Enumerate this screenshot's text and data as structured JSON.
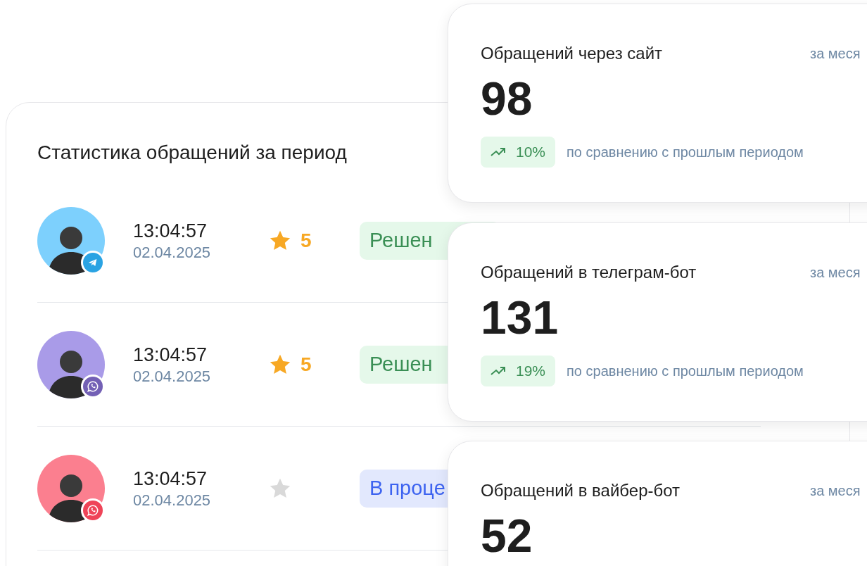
{
  "panel": {
    "title": "Статистика обращений за период",
    "rows": [
      {
        "time": "13:04:57",
        "date": "02.04.2025",
        "color": "#7dd0fd",
        "channel": {
          "kind": "telegram"
        },
        "rated": true,
        "rating": "5",
        "status": {
          "kind": "resolved",
          "label": "Решен"
        }
      },
      {
        "time": "13:04:57",
        "date": "02.04.2025",
        "color": "#a99be8",
        "channel": {
          "kind": "viber"
        },
        "rated": true,
        "rating": "5",
        "status": {
          "kind": "resolved",
          "label": "Решен"
        }
      },
      {
        "time": "13:04:57",
        "date": "02.04.2025",
        "color": "#fb7f8f",
        "channel": {
          "kind": "call"
        },
        "rated": false,
        "status": {
          "kind": "in_progress",
          "label": "В проце"
        }
      }
    ]
  },
  "stat_cards": [
    {
      "title": "Обращений через сайт",
      "period": "за меся",
      "value": "98",
      "change": "10%",
      "comparison": "по сравнению с прошлым периодом"
    },
    {
      "title": "Обращений в телеграм-бот",
      "period": "за меся",
      "value": "131",
      "change": "19%",
      "comparison": "по сравнению с прошлым периодом"
    },
    {
      "title": "Обращений в вайбер-бот",
      "period": "за меся",
      "value": "52"
    }
  ]
}
